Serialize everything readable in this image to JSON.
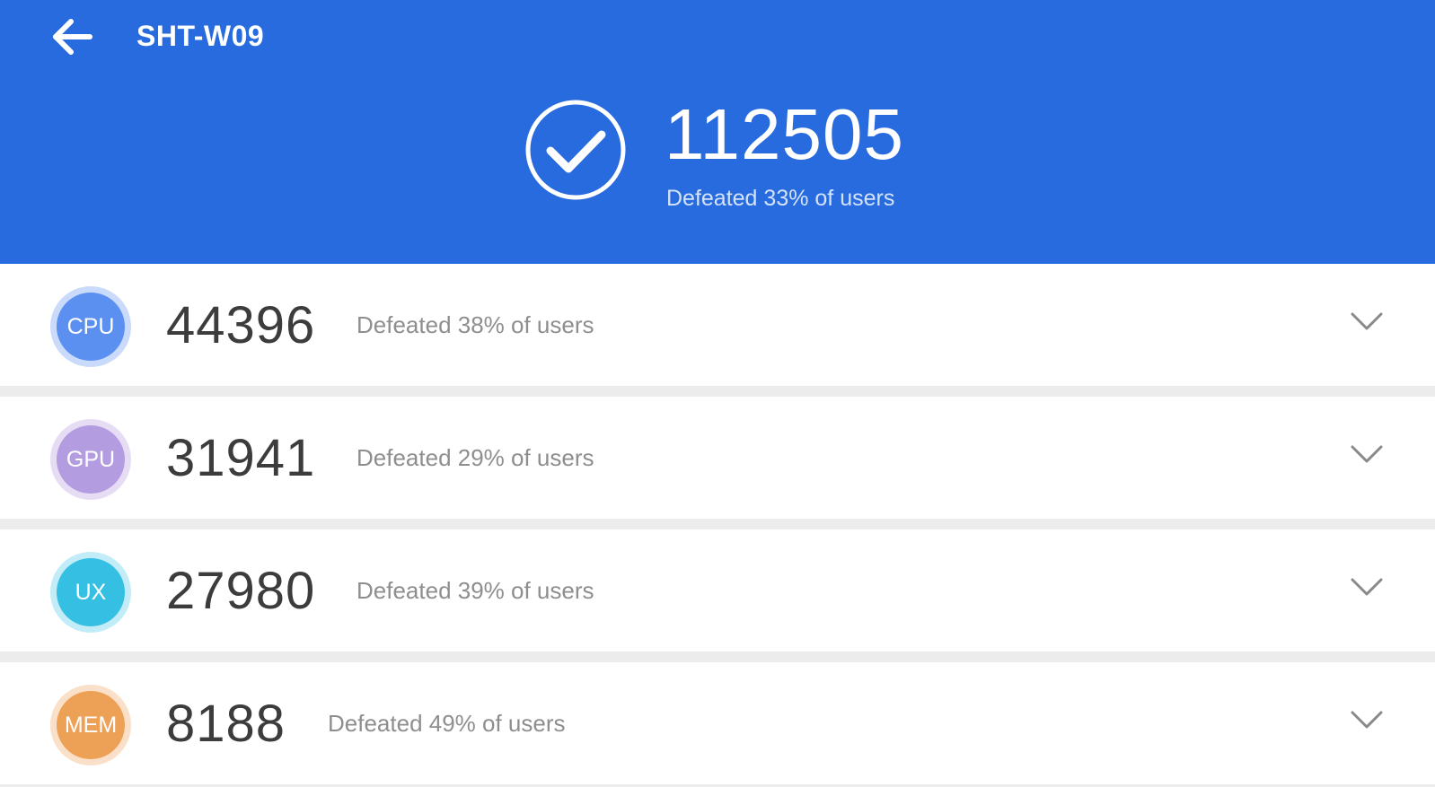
{
  "header": {
    "back_icon": "arrow-left-icon",
    "device_title": "SHT-W09",
    "status_icon": "check-circle-icon",
    "total_score": "112505",
    "total_defeated": "Defeated 33% of users",
    "background_color": "#276bdf"
  },
  "results": [
    {
      "label": "CPU",
      "score": "44396",
      "defeated": "Defeated 38% of users",
      "color": "#5b8ff0",
      "ring_color": "#c9dafb",
      "expand_icon": "chevron-down-icon"
    },
    {
      "label": "GPU",
      "score": "31941",
      "defeated": "Defeated 29% of users",
      "color": "#b39ce0",
      "ring_color": "#e6ddf5",
      "expand_icon": "chevron-down-icon"
    },
    {
      "label": "UX",
      "score": "27980",
      "defeated": "Defeated 39% of users",
      "color": "#35bfe2",
      "ring_color": "#c2ecf7",
      "expand_icon": "chevron-down-icon"
    },
    {
      "label": "MEM",
      "score": "8188",
      "defeated": "Defeated 49% of users",
      "color": "#eda157",
      "ring_color": "#fae0c8",
      "expand_icon": "chevron-down-icon"
    }
  ]
}
